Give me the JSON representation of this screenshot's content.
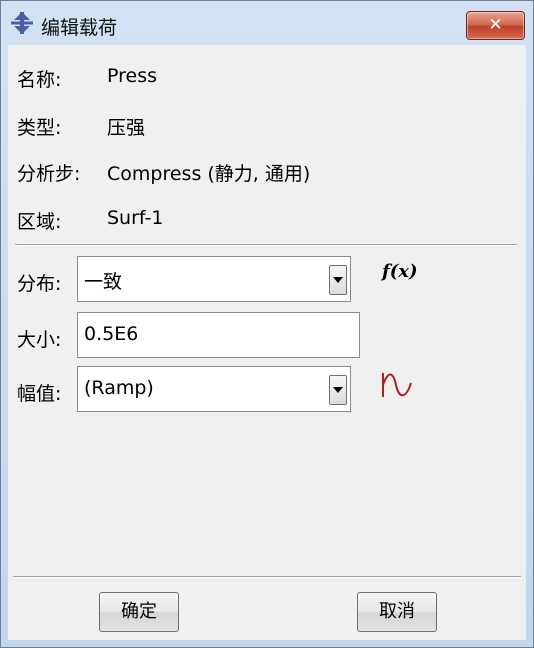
{
  "window": {
    "title": "编辑载荷",
    "close_label": "✕"
  },
  "info": [
    {
      "label": "名称:",
      "value": "Press"
    },
    {
      "label": "类型:",
      "value": "压强"
    },
    {
      "label": "分析步:",
      "value": "Compress (静力, 通用)"
    },
    {
      "label": "区域:",
      "value": "Surf-1"
    }
  ],
  "form": {
    "distribution": {
      "label": "分布:",
      "value": "一致",
      "icon": "f(x)"
    },
    "magnitude": {
      "label": "大小:",
      "value": "0.5E6"
    },
    "amplitude": {
      "label": "幅值:",
      "value": "(Ramp)"
    }
  },
  "buttons": {
    "ok": "确定",
    "cancel": "取消"
  },
  "colors": {
    "titlebar": "#c9dcf0",
    "close_button": "#c8472f",
    "amplitude_icon": "#b02020",
    "content_bg": "#f0f0f0"
  }
}
